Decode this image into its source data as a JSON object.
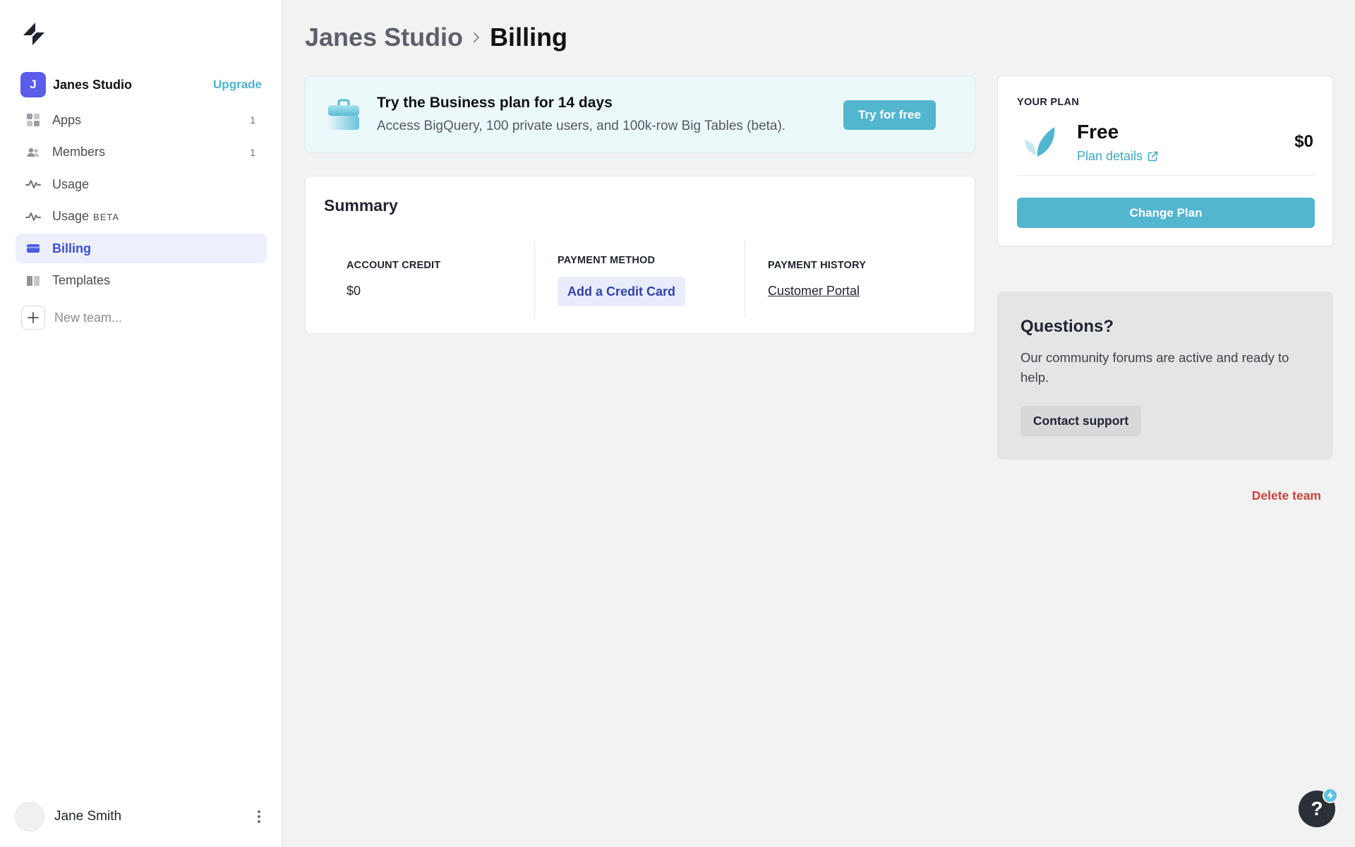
{
  "sidebar": {
    "team": {
      "initial": "J",
      "name": "Janes Studio",
      "upgrade_label": "Upgrade"
    },
    "nav": [
      {
        "label": "Apps",
        "count": "1",
        "icon": "grid-icon"
      },
      {
        "label": "Members",
        "count": "1",
        "icon": "users-icon"
      },
      {
        "label": "Usage",
        "count": "",
        "icon": "activity-icon"
      },
      {
        "label": "Usage",
        "badge": "BETA",
        "icon": "activity-icon"
      },
      {
        "label": "Billing",
        "count": "",
        "icon": "credit-card-icon",
        "active": true
      },
      {
        "label": "Templates",
        "count": "",
        "icon": "templates-icon"
      }
    ],
    "new_team_label": "New team...",
    "user": {
      "name": "Jane Smith"
    }
  },
  "header": {
    "team": "Janes Studio",
    "page": "Billing"
  },
  "promo": {
    "title": "Try the Business plan for 14 days",
    "subtitle": "Access BigQuery, 100 private users, and 100k-row Big Tables (beta).",
    "button": "Try for free"
  },
  "summary": {
    "title": "Summary",
    "account_credit": {
      "label": "ACCOUNT CREDIT",
      "value": "$0"
    },
    "payment_method": {
      "label": "PAYMENT METHOD",
      "button": "Add a Credit Card"
    },
    "payment_history": {
      "label": "PAYMENT HISTORY",
      "link": "Customer Portal"
    }
  },
  "plan": {
    "label": "YOUR PLAN",
    "name": "Free",
    "details_link": "Plan details",
    "price": "$0",
    "change_button": "Change Plan"
  },
  "questions": {
    "title": "Questions?",
    "text": "Our community forums are active and ready to help.",
    "button": "Contact support"
  },
  "delete_team_label": "Delete team",
  "help_label": "?",
  "colors": {
    "accent": "#52b6cf",
    "primary": "#3a4fd0",
    "danger": "#c5463d",
    "avatar": "#5b5ce8"
  }
}
